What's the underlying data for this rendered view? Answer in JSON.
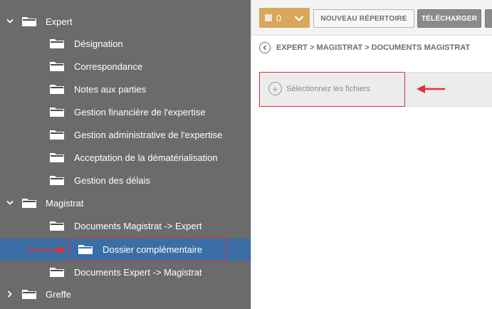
{
  "tree": {
    "nodes": [
      {
        "label": "Expert",
        "level": 0,
        "expander": "expanded"
      },
      {
        "label": "Désignation",
        "level": 1
      },
      {
        "label": "Correspondance",
        "level": 1
      },
      {
        "label": "Notes aux parties",
        "level": 1
      },
      {
        "label": "Gestion financière de l'expertise",
        "level": 1
      },
      {
        "label": "Gestion administrative de l'expertise",
        "level": 1
      },
      {
        "label": "Acceptation de la dématérialisation",
        "level": 1
      },
      {
        "label": "Gestion des délais",
        "level": 1
      },
      {
        "label": "Magistrat",
        "level": 0,
        "expander": "expanded"
      },
      {
        "label": "Documents Magistrat -> Expert",
        "level": 1
      },
      {
        "label": "Dossier complémentaire",
        "level": 2,
        "selected": true
      },
      {
        "label": "Documents Expert -> Magistrat",
        "level": 1
      },
      {
        "label": "Greffe",
        "level": 0,
        "expander": "collapsed"
      }
    ]
  },
  "toolbar": {
    "count": "0",
    "new_folder_label": "NOUVEAU RÉPERTOIRE",
    "download_label": "TÉLÉCHARGER"
  },
  "breadcrumb": {
    "text": "EXPERT > MAGISTRAT > DOCUMENTS MAGISTRAT"
  },
  "upload": {
    "select_files_label": "Sélectionnez les fichiers"
  },
  "colors": {
    "sidebar_bg": "#6b6b6b",
    "selected_bg": "#3a6ea5",
    "accent": "#d9a65a",
    "annotation_red": "#e0303a"
  },
  "icons": [
    "chevron-down-icon",
    "chevron-right-icon",
    "folder-icon",
    "back-icon",
    "plus-circle-icon",
    "arrow-annotation"
  ]
}
